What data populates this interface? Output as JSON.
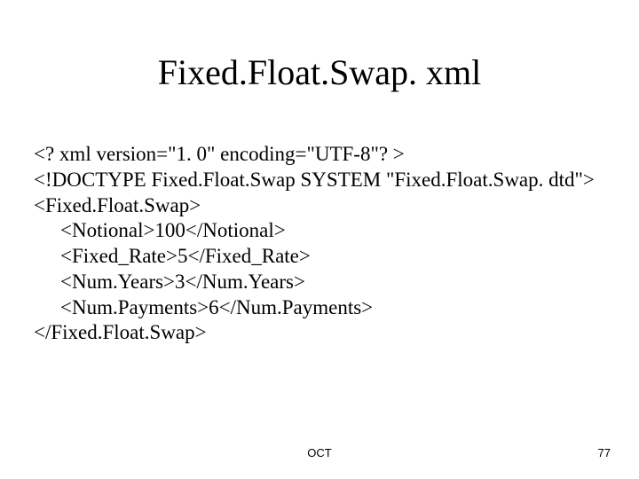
{
  "title": "Fixed.Float.Swap. xml",
  "lines": {
    "l0": "<? xml version=\"1. 0\" encoding=\"UTF-8\"? >",
    "l1": "<!DOCTYPE Fixed.Float.Swap SYSTEM \"Fixed.Float.Swap. dtd\">",
    "l2": "<Fixed.Float.Swap>",
    "l3": "<Notional>100</Notional>",
    "l4": "<Fixed_Rate>5</Fixed_Rate>",
    "l5": "<Num.Years>3</Num.Years>",
    "l6": "<Num.Payments>6</Num.Payments>",
    "l7": "</Fixed.Float.Swap>"
  },
  "footer": {
    "center": "OCT",
    "page": "77"
  }
}
